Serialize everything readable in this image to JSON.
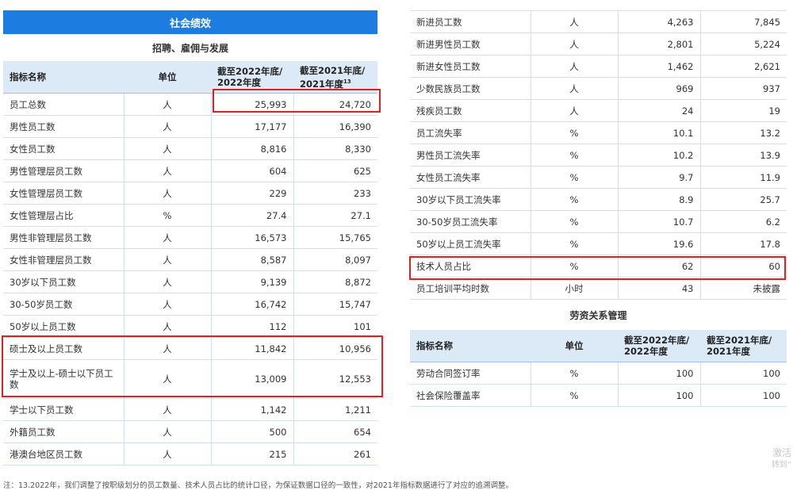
{
  "banner": "社会绩效",
  "left_subtitle": "招聘、雇佣与发展",
  "headers": {
    "name": "指标名称",
    "unit": "单位",
    "y2022_line1": "截至2022年底/",
    "y2022_line2": "2022年度",
    "y2021_line1": "截至2021年底/",
    "y2021_line2": "2021年度",
    "y2021_sup": "13"
  },
  "left_rows": [
    {
      "name": "员工总数",
      "unit": "人",
      "v2022": "25,993",
      "v2021": "24,720"
    },
    {
      "name": "男性员工数",
      "unit": "人",
      "v2022": "17,177",
      "v2021": "16,390"
    },
    {
      "name": "女性员工数",
      "unit": "人",
      "v2022": "8,816",
      "v2021": "8,330"
    },
    {
      "name": "男性管理层员工数",
      "unit": "人",
      "v2022": "604",
      "v2021": "625"
    },
    {
      "name": "女性管理层员工数",
      "unit": "人",
      "v2022": "229",
      "v2021": "233"
    },
    {
      "name": "女性管理层占比",
      "unit": "%",
      "v2022": "27.4",
      "v2021": "27.1"
    },
    {
      "name": "男性非管理层员工数",
      "unit": "人",
      "v2022": "16,573",
      "v2021": "15,765"
    },
    {
      "name": "女性非管理层员工数",
      "unit": "人",
      "v2022": "8,587",
      "v2021": "8,097"
    },
    {
      "name": "30岁以下员工数",
      "unit": "人",
      "v2022": "9,139",
      "v2021": "8,872"
    },
    {
      "name": "30-50岁员工数",
      "unit": "人",
      "v2022": "16,742",
      "v2021": "15,747"
    },
    {
      "name": "50岁以上员工数",
      "unit": "人",
      "v2022": "112",
      "v2021": "101"
    },
    {
      "name": "硕士及以上员工数",
      "unit": "人",
      "v2022": "11,842",
      "v2021": "10,956"
    },
    {
      "name": "学士及以上-硕士以下员工数",
      "unit": "人",
      "v2022": "13,009",
      "v2021": "12,553"
    },
    {
      "name": "学士以下员工数",
      "unit": "人",
      "v2022": "1,142",
      "v2021": "1,211"
    },
    {
      "name": "外籍员工数",
      "unit": "人",
      "v2022": "500",
      "v2021": "654"
    },
    {
      "name": "港澳台地区员工数",
      "unit": "人",
      "v2022": "215",
      "v2021": "261"
    }
  ],
  "right_rows": [
    {
      "name": "新进员工数",
      "unit": "人",
      "v2022": "4,263",
      "v2021": "7,845"
    },
    {
      "name": "新进男性员工数",
      "unit": "人",
      "v2022": "2,801",
      "v2021": "5,224"
    },
    {
      "name": "新进女性员工数",
      "unit": "人",
      "v2022": "1,462",
      "v2021": "2,621"
    },
    {
      "name": "少数民族员工数",
      "unit": "人",
      "v2022": "969",
      "v2021": "937"
    },
    {
      "name": "残疾员工数",
      "unit": "人",
      "v2022": "24",
      "v2021": "19"
    },
    {
      "name": "员工流失率",
      "unit": "%",
      "v2022": "10.1",
      "v2021": "13.2"
    },
    {
      "name": "男性员工流失率",
      "unit": "%",
      "v2022": "10.2",
      "v2021": "13.9"
    },
    {
      "name": "女性员工流失率",
      "unit": "%",
      "v2022": "9.7",
      "v2021": "11.9"
    },
    {
      "name": "30岁以下员工流失率",
      "unit": "%",
      "v2022": "8.9",
      "v2021": "25.7"
    },
    {
      "name": "30-50岁员工流失率",
      "unit": "%",
      "v2022": "10.7",
      "v2021": "6.2"
    },
    {
      "name": "50岁以上员工流失率",
      "unit": "%",
      "v2022": "19.6",
      "v2021": "17.8"
    },
    {
      "name": "技术人员占比",
      "unit": "%",
      "v2022": "62",
      "v2021": "60"
    },
    {
      "name": "员工培训平均时数",
      "unit": "小时",
      "v2022": "43",
      "v2021": "未披露"
    }
  ],
  "labor_title": "劳资关系管理",
  "labor_rows": [
    {
      "name": "劳动合同签订率",
      "unit": "%",
      "v2022": "100",
      "v2021": "100"
    },
    {
      "name": "社会保险覆盖率",
      "unit": "%",
      "v2022": "100",
      "v2021": "100"
    }
  ],
  "footnote": "注：13.2022年，我们调整了按职级划分的员工数量、技术人员占比的统计口径，为保证数据口径的一致性，对2021年指标数据进行了对应的追溯调整。",
  "watermark_line1": "激活",
  "watermark_line2": "转到“"
}
